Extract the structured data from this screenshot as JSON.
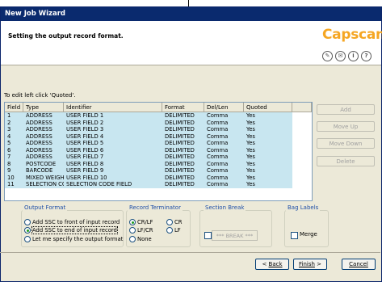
{
  "window": {
    "title": "New Job Wizard"
  },
  "header": {
    "title": "Setting the output record format.",
    "logo": "Capscan",
    "icons": [
      "edit-icon",
      "mail-icon",
      "info-icon",
      "help-icon"
    ]
  },
  "hint": "To edit left click 'Quoted'.",
  "table": {
    "columns": [
      "Field",
      "Type",
      "Identifier",
      "Format",
      "Del/Len",
      "Quoted"
    ],
    "rows": [
      [
        "1",
        "ADDRESS",
        "USER FIELD 1",
        "DELIMITED",
        "Comma",
        "Yes"
      ],
      [
        "2",
        "ADDRESS",
        "USER FIELD 2",
        "DELIMITED",
        "Comma",
        "Yes"
      ],
      [
        "3",
        "ADDRESS",
        "USER FIELD 3",
        "DELIMITED",
        "Comma",
        "Yes"
      ],
      [
        "4",
        "ADDRESS",
        "USER FIELD 4",
        "DELIMITED",
        "Comma",
        "Yes"
      ],
      [
        "5",
        "ADDRESS",
        "USER FIELD 5",
        "DELIMITED",
        "Comma",
        "Yes"
      ],
      [
        "6",
        "ADDRESS",
        "USER FIELD 6",
        "DELIMITED",
        "Comma",
        "Yes"
      ],
      [
        "7",
        "ADDRESS",
        "USER FIELD 7",
        "DELIMITED",
        "Comma",
        "Yes"
      ],
      [
        "8",
        "POSTCODE",
        "USER FIELD 8",
        "DELIMITED",
        "Comma",
        "Yes"
      ],
      [
        "9",
        "BARCODE",
        "USER FIELD 9",
        "DELIMITED",
        "Comma",
        "Yes"
      ],
      [
        "10",
        "MIXED WEIGHTS",
        "USER FIELD 10",
        "DELIMITED",
        "Comma",
        "Yes"
      ],
      [
        "11",
        "SELECTION CODE",
        "SELECTION CODE FIELD",
        "DELIMITED",
        "Comma",
        "Yes"
      ]
    ]
  },
  "side_buttons": {
    "add": "Add",
    "move_up": "Move Up",
    "move_down": "Move Down",
    "delete": "Delete"
  },
  "output_format": {
    "label": "Output Format",
    "options": [
      "Add SSC to front of input record",
      "Add SSC to end of input record",
      "Let me specify the output format"
    ],
    "selected": "Add SSC to end of input record"
  },
  "record_terminator": {
    "label": "Record Terminator",
    "options": [
      "CR/LF",
      "CR",
      "LF/CR",
      "LF",
      "None"
    ],
    "selected": "CR/LF"
  },
  "section_break": {
    "label": "Section Break",
    "value": "*** BREAK ***"
  },
  "bag_labels": {
    "label": "Bag Labels",
    "merge": "Merge"
  },
  "buttons": {
    "back": "Back",
    "finish": "Finish",
    "cancel": "Cancel"
  },
  "colors": {
    "title_bar": "#0a2a6e",
    "logo": "#f5a623",
    "row_highlight": "#c8e6f0",
    "group_label": "#2050a8"
  }
}
